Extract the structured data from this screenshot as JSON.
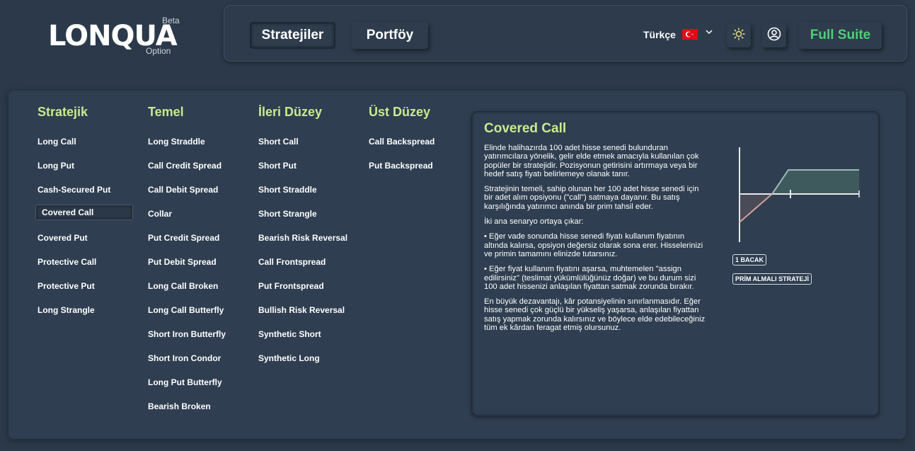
{
  "app": {
    "logo_text": "LONQUA",
    "logo_beta": "Beta",
    "logo_sub": "Option"
  },
  "nav": {
    "strategies_label": "Stratejiler",
    "portfolio_label": "Portföy",
    "language_label": "Türkçe",
    "full_suite_label": "Full Suite"
  },
  "menu": {
    "columns": [
      {
        "title": "Stratejik",
        "items": [
          "Long Call",
          "Long Put",
          "Cash-Secured Put",
          "Covered Call",
          "Covered Put",
          "Protective Call",
          "Protective Put",
          "Long Strangle"
        ]
      },
      {
        "title": "Temel",
        "items": [
          "Long Straddle",
          "Call Credit Spread",
          "Call Debit Spread",
          "Collar",
          "Put Credit Spread",
          "Put Debit Spread",
          "Long Call Broken",
          "Long Call Butterfly",
          "Short Iron Butterfly",
          "Short Iron Condor",
          "Long Put Butterfly",
          "Bearish Broken"
        ]
      },
      {
        "title": "İleri Düzey",
        "items": [
          "Short Call",
          "Short Put",
          "Short Straddle",
          "Short Strangle",
          "Bearish Risk Reversal",
          "Call Frontspread",
          "Put Frontspread",
          "Bullish Risk Reversal",
          "Synthetic Short",
          "Synthetic Long"
        ]
      },
      {
        "title": "Üst Düzey",
        "items": [
          "Call Backspread",
          "Put Backspread"
        ]
      }
    ],
    "selected": "Covered Call"
  },
  "detail": {
    "title": "Covered Call",
    "paragraphs": [
      "Elinde halihazırda 100 adet hisse senedi bulunduran yatırımcılara yönelik, gelir elde etmek amacıyla kullanılan çok popüler bir stratejidir. Pozisyonun getirisini artırmaya veya bir hedef satış fiyatı belirlemeye olanak tanır.",
      "Stratejinin temeli, sahip olunan her 100 adet hisse senedi için bir adet alım opsiyonu (\"call\") satmaya dayanır. Bu satış karşılığında yatırımcı anında bir prim tahsil eder.",
      "İki ana senaryo ortaya çıkar:",
      "• Eğer vade sonunda hisse senedi fiyatı kullanım fiyatının altında kalırsa, opsiyon değersiz olarak sona erer. Hisselerinizi ve primin tamamını elinizde tutarsınız.",
      "• Eğer fiyat kullanım fiyatını aşarsa, muhtemelen \"assign edilirsiniz\" (teslimat yükümlülüğünüz doğar) ve bu durum sizi 100 adet hissenizi anlaşılan fiyattan satmak zorunda bırakır.",
      "En büyük dezavantajı, kâr potansiyelinin sınırlanmasıdır. Eğer hisse senedi çok güçlü bir yükseliş yaşarsa, anlaşılan fiyattan satış yapmak zorunda kalırsınız ve böylece elde edebileceğiniz tüm ek kârdan feragat etmiş olursunuz."
    ],
    "tags": [
      "1 BACAK",
      "PRİM ALMALI STRATEJİ"
    ]
  },
  "colors": {
    "accent_green": "#c9ea8f",
    "full_suite_green": "#4fcf76",
    "loss_line": "#d6a39b",
    "profit_fill": "#3f5a5c"
  }
}
